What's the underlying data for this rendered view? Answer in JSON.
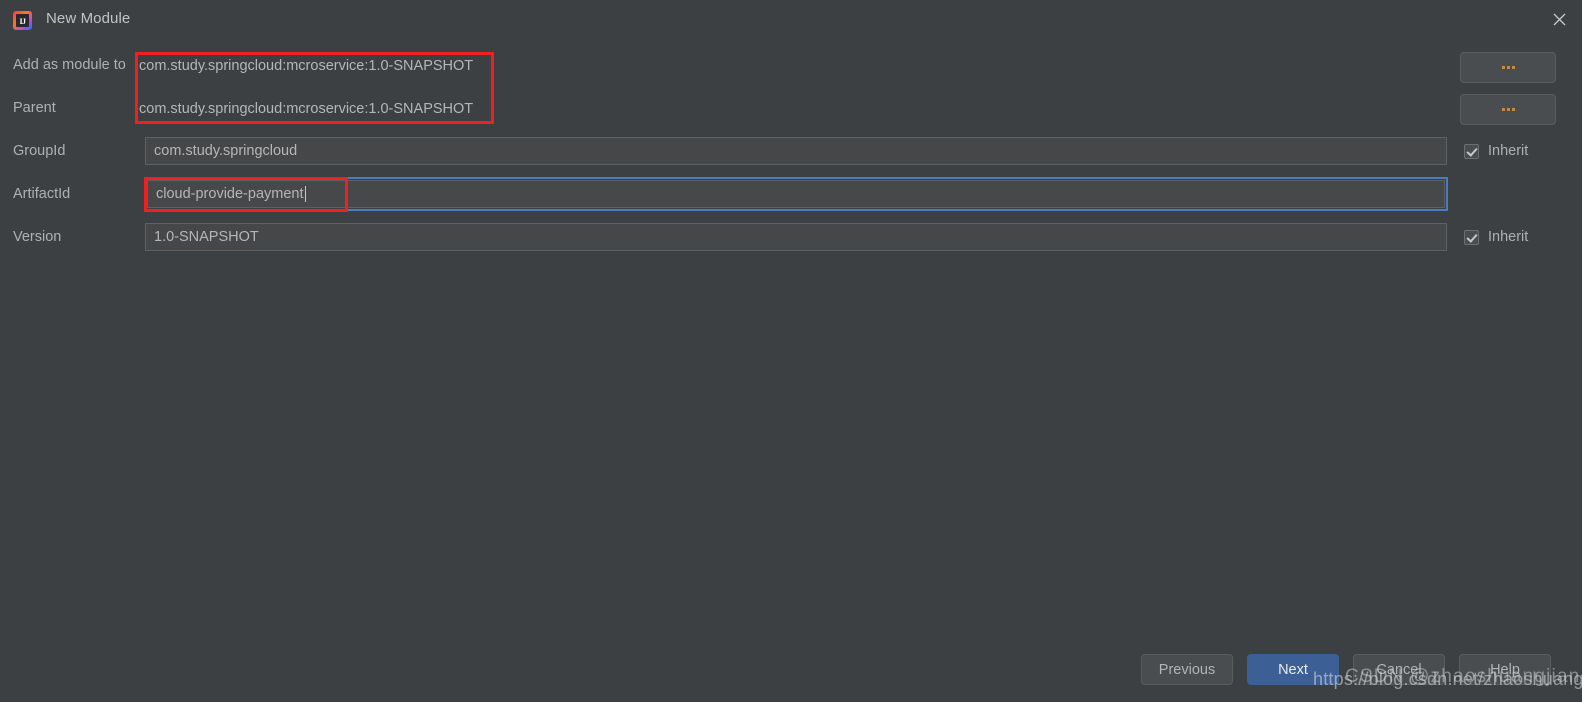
{
  "window": {
    "title": "New Module",
    "app_icon": "intellij-idea-icon",
    "close_icon": "close-icon",
    "background": "#3c4043"
  },
  "form": {
    "rows": [
      {
        "label": "Add as module to",
        "value": "com.study.springcloud:mcroservice:1.0-SNAPSHOT",
        "browse": "..."
      },
      {
        "label": "Parent",
        "value": "com.study.springcloud:mcroservice:1.0-SNAPSHOT",
        "browse": "..."
      }
    ],
    "group_id": {
      "label": "GroupId",
      "value": "com.study.springcloud",
      "inherit_label": "Inherit",
      "inherit_checked": true
    },
    "artifact_id": {
      "label": "ArtifactId",
      "value": "cloud-provide-payment",
      "focused": true
    },
    "version": {
      "label": "Version",
      "value": "1.0-SNAPSHOT",
      "inherit_label": "Inherit",
      "inherit_checked": true
    }
  },
  "footer": {
    "previous": "Previous",
    "next": "Next",
    "cancel": "Cancel",
    "help": "Help",
    "accent": "#3c6095"
  },
  "annotations": {
    "color": "#ef2020",
    "boxes": [
      "parent-coordinates-highlight",
      "artifact-id-highlight"
    ]
  },
  "watermarks": {
    "url": "https://blog.csdn.net/zhaoshuangjian",
    "handle": "CSDN @zhaoshuangjian"
  }
}
